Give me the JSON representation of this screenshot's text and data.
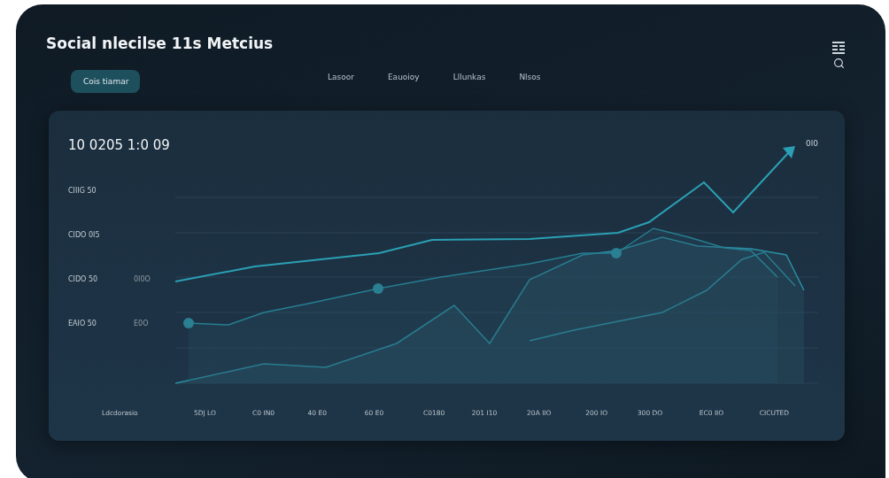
{
  "header": {
    "title": "Social nlecilse 11s Metcius",
    "nav": [
      {
        "label": "Lasoor"
      },
      {
        "label": "Eauoioy"
      },
      {
        "label": "Lllunkas"
      },
      {
        "label": "Nlsos"
      }
    ],
    "button": "Cois tiamar"
  },
  "chart_card": {
    "heading": "10 0205 1:0 09",
    "legend_label": "0l0",
    "y_labels": [
      {
        "primary": "CIIIG 50"
      },
      {
        "primary": "CIDO 0I5"
      },
      {
        "primary": "CIDO 50",
        "secondary": "0I0O"
      },
      {
        "primary": "EAIO 50",
        "secondary": "E0O"
      }
    ],
    "x_labels": [
      "Ldcdorasio",
      "5DJ LO",
      "C0 IN0",
      "40 E0",
      "60 E0",
      "C0180",
      "201 I10",
      "20A IIO",
      "200 IO",
      "300 DO",
      "EC0 IIO",
      "CICUTED"
    ]
  }
}
